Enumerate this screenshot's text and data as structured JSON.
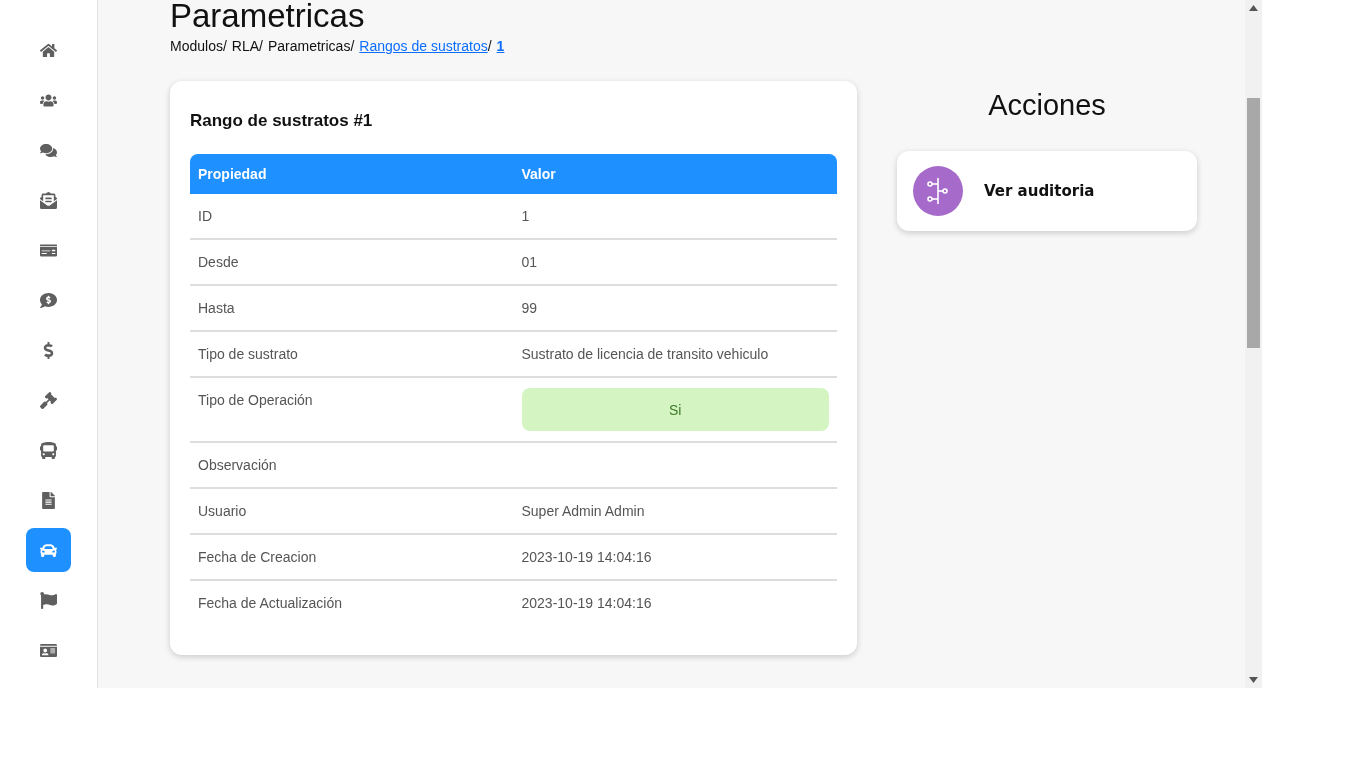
{
  "sidebar": {
    "items": [
      {
        "selected": false
      },
      {
        "selected": false
      },
      {
        "selected": false
      },
      {
        "selected": false
      },
      {
        "selected": false
      },
      {
        "selected": false
      },
      {
        "selected": false
      },
      {
        "selected": false
      },
      {
        "selected": false
      },
      {
        "selected": false
      },
      {
        "selected": true
      },
      {
        "selected": false
      },
      {
        "selected": false
      }
    ]
  },
  "page_title": "Parametricas",
  "breadcrumb": [
    {
      "label": "Modulos/",
      "kind": "text"
    },
    {
      "label": "RLA/",
      "kind": "text"
    },
    {
      "label": "Parametricas/",
      "kind": "text"
    },
    {
      "label": "Rangos de sustratos",
      "kind": "link",
      "separator": "/"
    },
    {
      "label": "1",
      "kind": "current"
    }
  ],
  "card": {
    "title": "Rango de sustratos #1",
    "columns": [
      "Propiedad",
      "Valor"
    ],
    "rows": [
      {
        "property": "ID",
        "value": "1",
        "kind": "text"
      },
      {
        "property": "Desde",
        "value": "01",
        "kind": "text"
      },
      {
        "property": "Hasta",
        "value": "99",
        "kind": "text"
      },
      {
        "property": "Tipo de sustrato",
        "value": "Sustrato de licencia de transito vehiculo",
        "kind": "text"
      },
      {
        "property": "Tipo de Operación",
        "value": "Si",
        "kind": "badge"
      },
      {
        "property": "Observación",
        "value": "",
        "kind": "text"
      },
      {
        "property": "Usuario",
        "value": "Super Admin Admin",
        "kind": "text"
      },
      {
        "property": "Fecha de Creacion",
        "value": "2023-10-19 14:04:16",
        "kind": "text"
      },
      {
        "property": "Fecha de Actualización",
        "value": "2023-10-19 14:04:16",
        "kind": "text"
      }
    ]
  },
  "actions": {
    "title": "Acciones",
    "items": [
      {
        "label": "Ver auditoria"
      }
    ]
  }
}
